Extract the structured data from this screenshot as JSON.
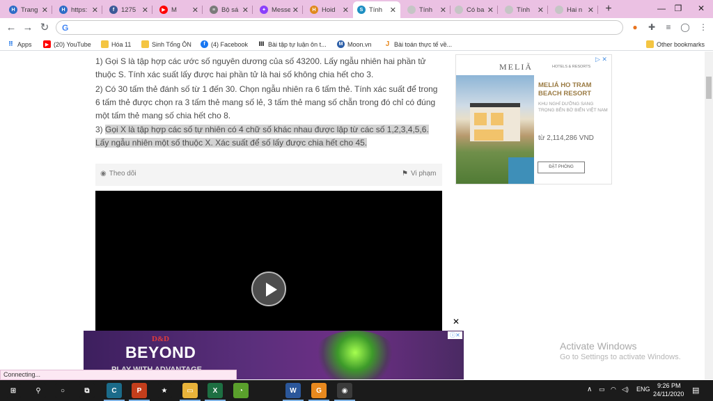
{
  "tabs": [
    {
      "label": "Trang",
      "icon": "hoc24-icon",
      "color": "#2d6cc7",
      "glyph": "H"
    },
    {
      "label": "https:",
      "icon": "hoc24-icon",
      "color": "#2d6cc7",
      "glyph": "H"
    },
    {
      "label": "1275",
      "icon": "facebook-icon",
      "color": "#3b5998",
      "glyph": "f"
    },
    {
      "label": "M",
      "icon": "youtube-icon",
      "color": "#ff0000",
      "glyph": "▶"
    },
    {
      "label": "Bộ sá",
      "icon": "doc-icon",
      "color": "#7a7a7a",
      "glyph": "≡"
    },
    {
      "label": "Messe",
      "icon": "messenger-icon",
      "color": "#8a3ffc",
      "glyph": "✦"
    },
    {
      "label": "Hoid",
      "icon": "hoidap-icon",
      "color": "#e08a1e",
      "glyph": "H"
    },
    {
      "label": "Tính",
      "icon": "tab-page-icon",
      "color": "#1e8fc2",
      "glyph": "S"
    },
    {
      "label": "Tính",
      "icon": "loading-icon",
      "color": "#c5c5c5",
      "glyph": ""
    },
    {
      "label": "Có ba",
      "icon": "loading-icon",
      "color": "#c5c5c5",
      "glyph": ""
    },
    {
      "label": "Tính",
      "icon": "loading-icon",
      "color": "#c5c5c5",
      "glyph": ""
    },
    {
      "label": "Hai n",
      "icon": "loading-icon",
      "color": "#c5c5c5",
      "glyph": ""
    }
  ],
  "bookmarks": [
    {
      "label": "Apps",
      "icon": "apps-grid-icon"
    },
    {
      "label": "(20) YouTube",
      "icon": "youtube-icon"
    },
    {
      "label": "Hóa 11",
      "icon": "folder-icon"
    },
    {
      "label": "Sinh Tổng ÔN",
      "icon": "folder-icon"
    },
    {
      "label": "(4) Facebook",
      "icon": "facebook-icon"
    },
    {
      "label": "Bài tập tự luận ôn t...",
      "icon": "book-icon"
    },
    {
      "label": "Moon.vn",
      "icon": "moon-icon"
    },
    {
      "label": "Bài toán thực tế về...",
      "icon": "j-icon"
    },
    {
      "label": "Other bookmarks",
      "icon": "folder-icon"
    }
  ],
  "questions": [
    "1) Gọi S là tập hợp các ước số nguyên dương của số 43200. Lấy ngẫu nhiên hai phần tử thuộc S. Tính xác suất lấy được hai phần tử là hai số không chia hết cho 3.",
    "2) Có 30 tấm thẻ đánh số từ 1 đến 30. Chọn ngẫu nhiên ra 6 tấm thẻ. Tính xác suất để trong 6 tấm thẻ được chọn ra 3 tấm thẻ mang số lẻ, 3 tấm thẻ mang số chẵn trong đó chỉ có đúng một tấm thẻ mang số chia hết cho 8."
  ],
  "question3_prefix": "3) ",
  "question3_highlight": "Gọi X là tập hợp các số tự nhiên có 4 chữ số khác nhau được lập từ các số 1,2,3,4,5,6. Lấy ngẫu nhiên một số thuộc X. Xác suất để số lấy được chia hết cho 45.",
  "actions": {
    "follow": "Theo dõi",
    "report": "Vi phạm"
  },
  "ad_right": {
    "brand": "MELIÃ",
    "brand_sub": "HOTELS & RESORTS",
    "headline": "MELIÁ HO TRAM BEACH RESORT",
    "text": "KHU NGHỈ DƯỠNG SANG TRỌNG BÊN BỜ BIỂN VIỆT NAM",
    "price": "từ 2,114,286 VND",
    "cta": "ĐẶT PHÒNG"
  },
  "ad_bottom": {
    "logo": "D&D",
    "title": "BEYOND",
    "sub": "PLAY WITH ADVANTAGE"
  },
  "watermark": {
    "line1": "Activate Windows",
    "line2": "Go to Settings to activate Windows."
  },
  "status": "Connecting...",
  "tray": {
    "lang": "ENG",
    "time": "9:26 PM",
    "date": "24/11/2020"
  },
  "taskbar_apps": [
    {
      "name": "windows-start-icon",
      "glyph": "⊞",
      "color": "#1b1b1b"
    },
    {
      "name": "search-icon",
      "glyph": "⚲",
      "color": "#1b1b1b"
    },
    {
      "name": "cortana-icon",
      "glyph": "○",
      "color": "#1b1b1b"
    },
    {
      "name": "task-view-icon",
      "glyph": "⧉",
      "color": "#1b1b1b"
    },
    {
      "name": "app-c-icon",
      "glyph": "C",
      "color": "#1b6b8a"
    },
    {
      "name": "powerpoint-icon",
      "glyph": "P",
      "color": "#c43e1c"
    },
    {
      "name": "star-app-icon",
      "glyph": "★",
      "color": "#1b1b1b"
    },
    {
      "name": "file-explorer-icon",
      "glyph": "▭",
      "color": "#e8b33a"
    },
    {
      "name": "excel-icon",
      "glyph": "X",
      "color": "#1d6f42"
    },
    {
      "name": "green-app-icon",
      "glyph": "◔",
      "color": "#5aa02c"
    },
    {
      "name": "word-icon",
      "glyph": "W",
      "color": "#2b579a"
    },
    {
      "name": "orange-app-icon",
      "glyph": "G",
      "color": "#e8891e"
    },
    {
      "name": "chrome-icon",
      "glyph": "◉",
      "color": "#3b3b3b"
    }
  ]
}
